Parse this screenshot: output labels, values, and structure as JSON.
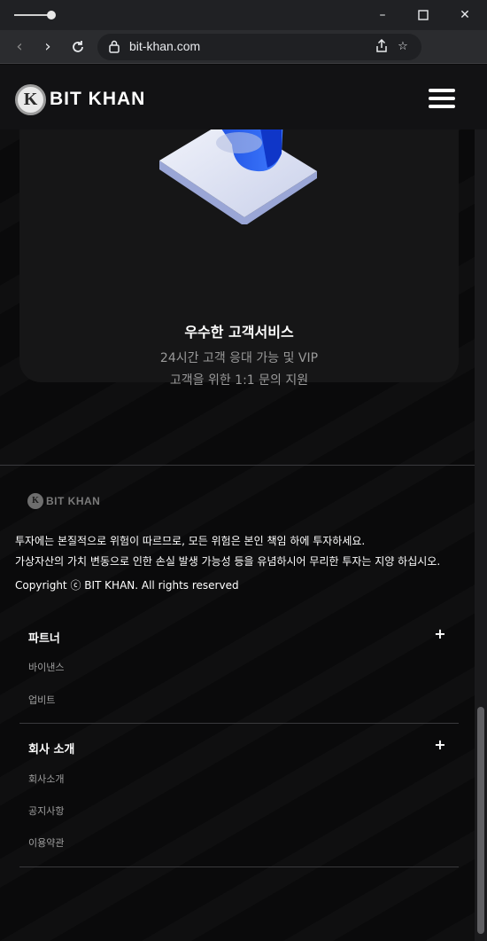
{
  "browser": {
    "url": "bit-khan.com",
    "tab_count": "1",
    "icons": [
      "back-icon",
      "forward-icon",
      "reload-icon",
      "lock-icon",
      "share-icon",
      "bookmark-icon",
      "tabs-icon",
      "menu-icon"
    ]
  },
  "header": {
    "logo_mark": "K",
    "logo_text": "BIT KHAN"
  },
  "card": {
    "title": "우수한 고객서비스",
    "desc_line1": "24시간 고객 응대 가능 및 VIP",
    "desc_line2": "고객을 위한 1:1 문의 지원"
  },
  "footer": {
    "logo_mark": "K",
    "logo_text": "BIT KHAN",
    "disclaimer1": "투자에는 본질적으로 위험이 따르므로, 모든 위험은 본인 책임 하에 투자하세요.",
    "disclaimer2": "가상자산의 가치 변동으로 인한 손실 발생 가능성 등을 유념하시어 무리한 투자는 지양 하십시오.",
    "copyright": "Copyright ⓒ BIT KHAN. All rights reserved"
  },
  "accordions": [
    {
      "title": "파트너",
      "toggle": "+",
      "links": [
        "바이낸스",
        "업비트"
      ]
    },
    {
      "title": "회사 소개",
      "toggle": "+",
      "links": [
        "회사소개",
        "공지사항",
        "이용약관"
      ]
    }
  ],
  "colors": {
    "background": "#0a0a0b",
    "card": "#161617",
    "accent_blue": "#2f6bff"
  }
}
